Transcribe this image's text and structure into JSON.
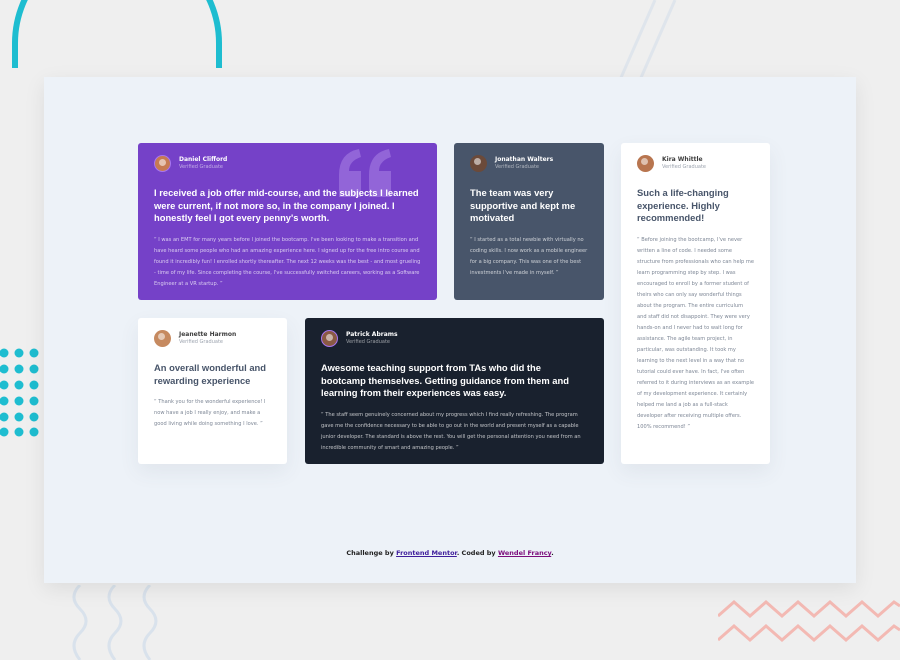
{
  "footer": {
    "prefix": "Challenge by",
    "link1": "Frontend Mentor",
    "middle": ". Coded by",
    "link2": "Wendel Francy",
    "suffix": "."
  },
  "testimonials": [
    {
      "name": "Daniel Clifford",
      "role": "Verified Graduate",
      "title": "I received a job offer mid-course, and the subjects I learned were current, if not more so, in the company I joined. I honestly feel I got every penny's worth.",
      "body": "“ I was an EMT for many years before I joined the bootcamp. I've been looking to make a transition and have heard some people who had an amazing experience here. I signed up for the free intro course and found it incredibly fun! I enrolled shortly thereafter. The next 12 weeks was the best - and most grueling - time of my life. Since completing the course, I've successfully switched careers, working as a Software Engineer at a VR startup. ”"
    },
    {
      "name": "Jonathan Walters",
      "role": "Verified Graduate",
      "title": "The team was very supportive and kept me motivated",
      "body": "“ I started as a total newbie with virtually no coding skills. I now work as a mobile engineer for a big company. This was one of the best investments I've made in myself. ”"
    },
    {
      "name": "Kira Whittle",
      "role": "Verified Graduate",
      "title": "Such a life-changing experience. Highly recommended!",
      "body": "“ Before joining the bootcamp, I've never written a line of code. I needed some structure from professionals who can help me learn programming step by step. I was encouraged to enroll by a former student of theirs who can only say wonderful things about the program. The entire curriculum and staff did not disappoint. They were very hands-on and I never had to wait long for assistance. The agile team project, in particular, was outstanding. It took my learning to the next level in a way that no tutorial could ever have. In fact, I've often referred to it during interviews as an example of my development experience. It certainly helped me land a job as a full-stack developer after receiving multiple offers. 100% recommend! ”"
    },
    {
      "name": "Jeanette Harmon",
      "role": "Verified Graduate",
      "title": "An overall wonderful and rewarding experience",
      "body": "“ Thank you for the wonderful experience! I now have a job I really enjoy, and make a good living while doing something I love. ”"
    },
    {
      "name": "Patrick Abrams",
      "role": "Verified Graduate",
      "title": "Awesome teaching support from TAs who did the bootcamp themselves. Getting guidance from them and learning from their experiences was easy.",
      "body": "“ The staff seem genuinely concerned about my progress which I find really refreshing. The program gave me the confidence necessary to be able to go out in the world and present myself as a capable junior developer. The standard is above the rest. You will get the personal attention you need from an incredible community of smart and amazing people. ”"
    }
  ],
  "colors": {
    "purple": "#7541c8",
    "slate": "#48556a",
    "dark": "#19212e",
    "accent_cyan": "#1ebdd0",
    "accent_pink": "#f3b9b3"
  }
}
